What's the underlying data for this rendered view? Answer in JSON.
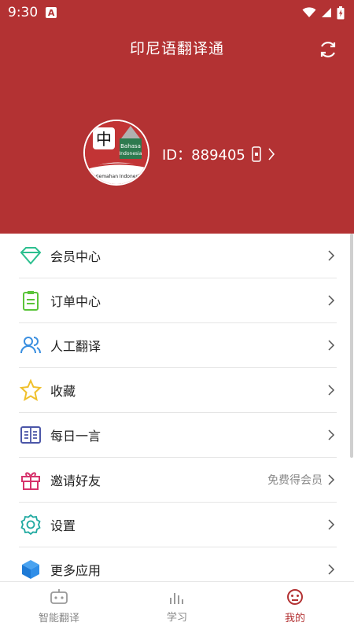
{
  "status": {
    "time": "9:30",
    "badge": "A"
  },
  "header": {
    "title": "印尼语翻译通"
  },
  "user": {
    "id_label": "ID：889405",
    "avatar_big_char": "中",
    "avatar_text1": "Bahasa",
    "avatar_text2": "Indonesia",
    "avatar_text3": "Terjemahan Indonesia"
  },
  "menu": [
    {
      "label": "会员中心",
      "icon": "diamond-icon",
      "extra": ""
    },
    {
      "label": "订单中心",
      "icon": "clipboard-icon",
      "extra": ""
    },
    {
      "label": "人工翻译",
      "icon": "users-icon",
      "extra": ""
    },
    {
      "label": "收藏",
      "icon": "star-icon",
      "extra": ""
    },
    {
      "label": "每日一言",
      "icon": "book-icon",
      "extra": ""
    },
    {
      "label": "邀请好友",
      "icon": "gift-icon",
      "extra": "免费得会员"
    },
    {
      "label": "设置",
      "icon": "gear-icon",
      "extra": ""
    },
    {
      "label": "更多应用",
      "icon": "cube-icon",
      "extra": ""
    }
  ],
  "nav": [
    {
      "label": "智能翻译",
      "icon": "robot-icon"
    },
    {
      "label": "学习",
      "icon": "bars-icon"
    },
    {
      "label": "我的",
      "icon": "face-icon"
    }
  ],
  "colors": {
    "brand": "#b33233",
    "active": "#b33233"
  }
}
